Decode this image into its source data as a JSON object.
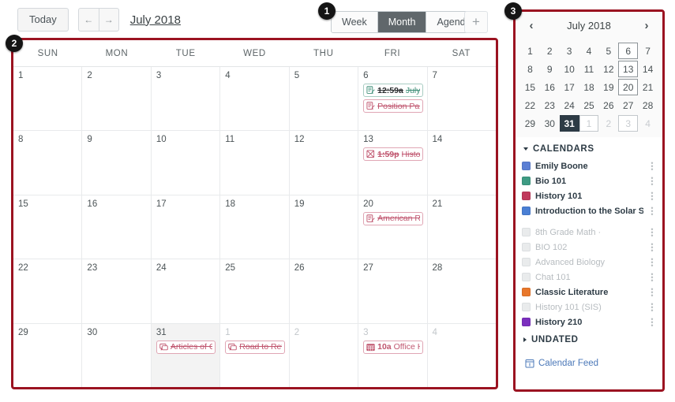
{
  "toolbar": {
    "today_label": "Today",
    "prev_icon": "arrow-left-icon",
    "prev_label": "←",
    "next_icon": "arrow-right-icon",
    "next_label": "→",
    "month_title": "July 2018",
    "add_label": "+"
  },
  "views": {
    "options": [
      "Week",
      "Month",
      "Agenda"
    ],
    "selected": "Month"
  },
  "calendar": {
    "weekday_headers": [
      "SUN",
      "MON",
      "TUE",
      "WED",
      "THU",
      "FRI",
      "SAT"
    ],
    "weeks": [
      [
        {
          "num": "1",
          "other": false,
          "today": false,
          "events": []
        },
        {
          "num": "2",
          "other": false,
          "today": false,
          "events": []
        },
        {
          "num": "3",
          "other": false,
          "today": false,
          "events": []
        },
        {
          "num": "4",
          "other": false,
          "today": false,
          "events": []
        },
        {
          "num": "5",
          "other": false,
          "today": false,
          "events": []
        },
        {
          "num": "6",
          "other": false,
          "today": false,
          "events": [
            {
              "time": "12:59a",
              "title": "July-St",
              "color": "green",
              "struck": true,
              "icon": "assignment-icon"
            },
            {
              "time": "",
              "title": "Position Pape",
              "color": "pink",
              "struck": true,
              "icon": "assignment-icon"
            }
          ]
        },
        {
          "num": "7",
          "other": false,
          "today": false,
          "events": []
        }
      ],
      [
        {
          "num": "8",
          "other": false,
          "today": false,
          "events": []
        },
        {
          "num": "9",
          "other": false,
          "today": false,
          "events": []
        },
        {
          "num": "10",
          "other": false,
          "today": false,
          "events": []
        },
        {
          "num": "11",
          "other": false,
          "today": false,
          "events": []
        },
        {
          "num": "12",
          "other": false,
          "today": false,
          "events": []
        },
        {
          "num": "13",
          "other": false,
          "today": false,
          "events": [
            {
              "time": "1:59p",
              "title": "History",
              "color": "pink",
              "struck": true,
              "icon": "quiz-icon"
            }
          ]
        },
        {
          "num": "14",
          "other": false,
          "today": false,
          "events": []
        }
      ],
      [
        {
          "num": "15",
          "other": false,
          "today": false,
          "events": []
        },
        {
          "num": "16",
          "other": false,
          "today": false,
          "events": []
        },
        {
          "num": "17",
          "other": false,
          "today": false,
          "events": []
        },
        {
          "num": "18",
          "other": false,
          "today": false,
          "events": []
        },
        {
          "num": "19",
          "other": false,
          "today": false,
          "events": []
        },
        {
          "num": "20",
          "other": false,
          "today": false,
          "events": [
            {
              "time": "",
              "title": "American Rev",
              "color": "pink",
              "struck": true,
              "icon": "assignment-icon"
            }
          ]
        },
        {
          "num": "21",
          "other": false,
          "today": false,
          "events": []
        }
      ],
      [
        {
          "num": "22",
          "other": false,
          "today": false,
          "events": []
        },
        {
          "num": "23",
          "other": false,
          "today": false,
          "events": []
        },
        {
          "num": "24",
          "other": false,
          "today": false,
          "events": []
        },
        {
          "num": "25",
          "other": false,
          "today": false,
          "events": []
        },
        {
          "num": "26",
          "other": false,
          "today": false,
          "events": []
        },
        {
          "num": "27",
          "other": false,
          "today": false,
          "events": []
        },
        {
          "num": "28",
          "other": false,
          "today": false,
          "events": []
        }
      ],
      [
        {
          "num": "29",
          "other": false,
          "today": false,
          "events": []
        },
        {
          "num": "30",
          "other": false,
          "today": false,
          "events": []
        },
        {
          "num": "31",
          "other": false,
          "today": true,
          "events": [
            {
              "time": "",
              "title": "Articles of Co",
              "color": "pink",
              "struck": true,
              "icon": "discussion-icon"
            }
          ]
        },
        {
          "num": "1",
          "other": true,
          "today": false,
          "events": [
            {
              "time": "",
              "title": "Road to Revo",
              "color": "pink",
              "struck": true,
              "icon": "discussion-icon"
            }
          ]
        },
        {
          "num": "2",
          "other": true,
          "today": false,
          "events": []
        },
        {
          "num": "3",
          "other": true,
          "today": false,
          "events": [
            {
              "time": "10a",
              "title": "Office Ho",
              "color": "pink",
              "struck": false,
              "icon": "calendar-event-icon"
            }
          ]
        },
        {
          "num": "4",
          "other": true,
          "today": false,
          "events": []
        }
      ]
    ]
  },
  "sidebar": {
    "mini": {
      "prev_label": "‹",
      "next_label": "›",
      "title": "July 2018",
      "days": [
        {
          "n": "1",
          "dim": false,
          "boxed": false,
          "today": false
        },
        {
          "n": "2",
          "dim": false,
          "boxed": false,
          "today": false
        },
        {
          "n": "3",
          "dim": false,
          "boxed": false,
          "today": false
        },
        {
          "n": "4",
          "dim": false,
          "boxed": false,
          "today": false
        },
        {
          "n": "5",
          "dim": false,
          "boxed": false,
          "today": false
        },
        {
          "n": "6",
          "dim": false,
          "boxed": true,
          "today": false
        },
        {
          "n": "7",
          "dim": false,
          "boxed": false,
          "today": false
        },
        {
          "n": "8",
          "dim": false,
          "boxed": false,
          "today": false
        },
        {
          "n": "9",
          "dim": false,
          "boxed": false,
          "today": false
        },
        {
          "n": "10",
          "dim": false,
          "boxed": false,
          "today": false
        },
        {
          "n": "11",
          "dim": false,
          "boxed": false,
          "today": false
        },
        {
          "n": "12",
          "dim": false,
          "boxed": false,
          "today": false
        },
        {
          "n": "13",
          "dim": false,
          "boxed": true,
          "today": false
        },
        {
          "n": "14",
          "dim": false,
          "boxed": false,
          "today": false
        },
        {
          "n": "15",
          "dim": false,
          "boxed": false,
          "today": false
        },
        {
          "n": "16",
          "dim": false,
          "boxed": false,
          "today": false
        },
        {
          "n": "17",
          "dim": false,
          "boxed": false,
          "today": false
        },
        {
          "n": "18",
          "dim": false,
          "boxed": false,
          "today": false
        },
        {
          "n": "19",
          "dim": false,
          "boxed": false,
          "today": false
        },
        {
          "n": "20",
          "dim": false,
          "boxed": true,
          "today": false
        },
        {
          "n": "21",
          "dim": false,
          "boxed": false,
          "today": false
        },
        {
          "n": "22",
          "dim": false,
          "boxed": false,
          "today": false
        },
        {
          "n": "23",
          "dim": false,
          "boxed": false,
          "today": false
        },
        {
          "n": "24",
          "dim": false,
          "boxed": false,
          "today": false
        },
        {
          "n": "25",
          "dim": false,
          "boxed": false,
          "today": false
        },
        {
          "n": "26",
          "dim": false,
          "boxed": false,
          "today": false
        },
        {
          "n": "27",
          "dim": false,
          "boxed": false,
          "today": false
        },
        {
          "n": "28",
          "dim": false,
          "boxed": false,
          "today": false
        },
        {
          "n": "29",
          "dim": false,
          "boxed": false,
          "today": false
        },
        {
          "n": "30",
          "dim": false,
          "boxed": false,
          "today": false
        },
        {
          "n": "31",
          "dim": false,
          "boxed": false,
          "today": true
        },
        {
          "n": "1",
          "dim": true,
          "boxed": true,
          "today": false
        },
        {
          "n": "2",
          "dim": true,
          "boxed": false,
          "today": false
        },
        {
          "n": "3",
          "dim": true,
          "boxed": true,
          "today": false
        },
        {
          "n": "4",
          "dim": true,
          "boxed": false,
          "today": false
        }
      ]
    },
    "calendars_header": "CALENDARS",
    "calendars": [
      {
        "name": "Emily Boone",
        "color": "#5b7fd4",
        "on": true
      },
      {
        "name": "Bio 101",
        "color": "#3e9b83",
        "on": true
      },
      {
        "name": "History 101",
        "color": "#c0395c",
        "on": true
      },
      {
        "name": "Introduction to the Solar System",
        "color": "#4a7fd4",
        "on": true
      },
      {
        "name": "8th Grade Math ·",
        "color": "#e9ebec",
        "on": false
      },
      {
        "name": "BIO 102",
        "color": "#e9ebec",
        "on": false
      },
      {
        "name": "Advanced Biology",
        "color": "#e9ebec",
        "on": false
      },
      {
        "name": "Chat 101",
        "color": "#e9ebec",
        "on": false
      },
      {
        "name": "Classic Literature",
        "color": "#e8772a",
        "on": true
      },
      {
        "name": "History 101 (SIS)",
        "color": "#e9ebec",
        "on": false
      },
      {
        "name": "History 210",
        "color": "#7b2fbe",
        "on": true
      }
    ],
    "undated_header": "UNDATED",
    "feed_label": "Calendar Feed",
    "feed_icon": "calendar-feed-icon"
  },
  "callouts": [
    {
      "id": "badge1",
      "label": "1"
    },
    {
      "id": "badge2",
      "label": "2"
    },
    {
      "id": "badge3",
      "label": "3"
    }
  ]
}
